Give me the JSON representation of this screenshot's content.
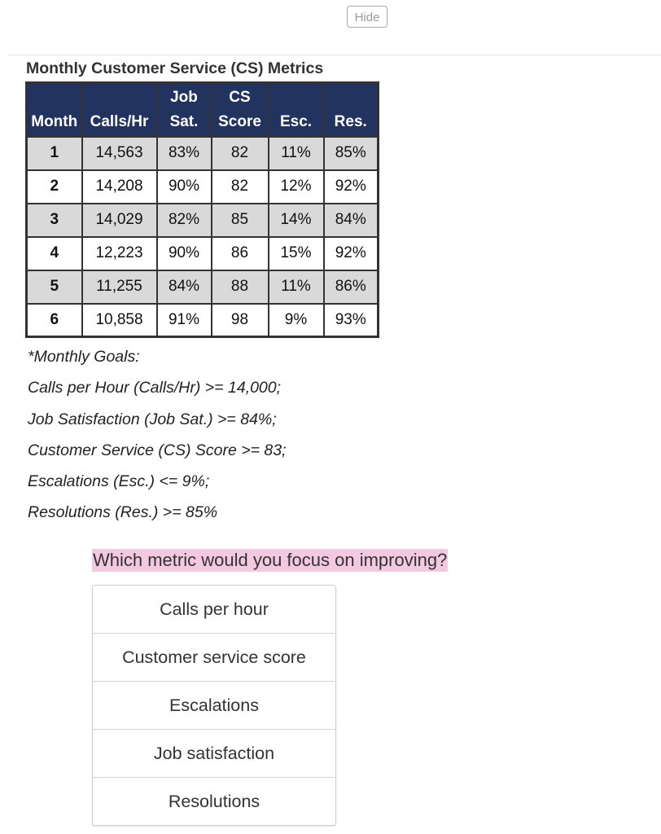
{
  "toolbar": {
    "hide_label": "Hide"
  },
  "table": {
    "title": "Monthly Customer Service (CS) Metrics",
    "headers": [
      {
        "line1": "",
        "line2": "Month"
      },
      {
        "line1": "",
        "line2": "Calls/Hr"
      },
      {
        "line1": "Job",
        "line2": "Sat."
      },
      {
        "line1": "CS",
        "line2": "Score"
      },
      {
        "line1": "",
        "line2": "Esc."
      },
      {
        "line1": "",
        "line2": "Res."
      }
    ],
    "rows": [
      [
        "1",
        "14,563",
        "83%",
        "82",
        "11%",
        "85%"
      ],
      [
        "2",
        "14,208",
        "90%",
        "82",
        "12%",
        "92%"
      ],
      [
        "3",
        "14,029",
        "82%",
        "85",
        "14%",
        "84%"
      ],
      [
        "4",
        "12,223",
        "90%",
        "86",
        "15%",
        "92%"
      ],
      [
        "5",
        "11,255",
        "84%",
        "88",
        "11%",
        "86%"
      ],
      [
        "6",
        "10,858",
        "91%",
        "98",
        "9%",
        "93%"
      ]
    ],
    "header_bg": "#23335f",
    "stripe_bg": "#d9d9d9"
  },
  "goals": {
    "heading": "*Monthly Goals:",
    "items": [
      "Calls per Hour (Calls/Hr) >= 14,000;",
      "Job Satisfaction (Job Sat.) >= 84%;",
      "Customer Service (CS) Score >= 83;",
      "Escalations (Esc.) <= 9%;",
      "Resolutions (Res.) >= 85%"
    ]
  },
  "question": {
    "prompt": "Which metric would you focus on improving?",
    "highlight_color": "#f3c9e1",
    "options": [
      "Calls per hour",
      "Customer service score",
      "Escalations",
      "Job satisfaction",
      "Resolutions"
    ]
  }
}
